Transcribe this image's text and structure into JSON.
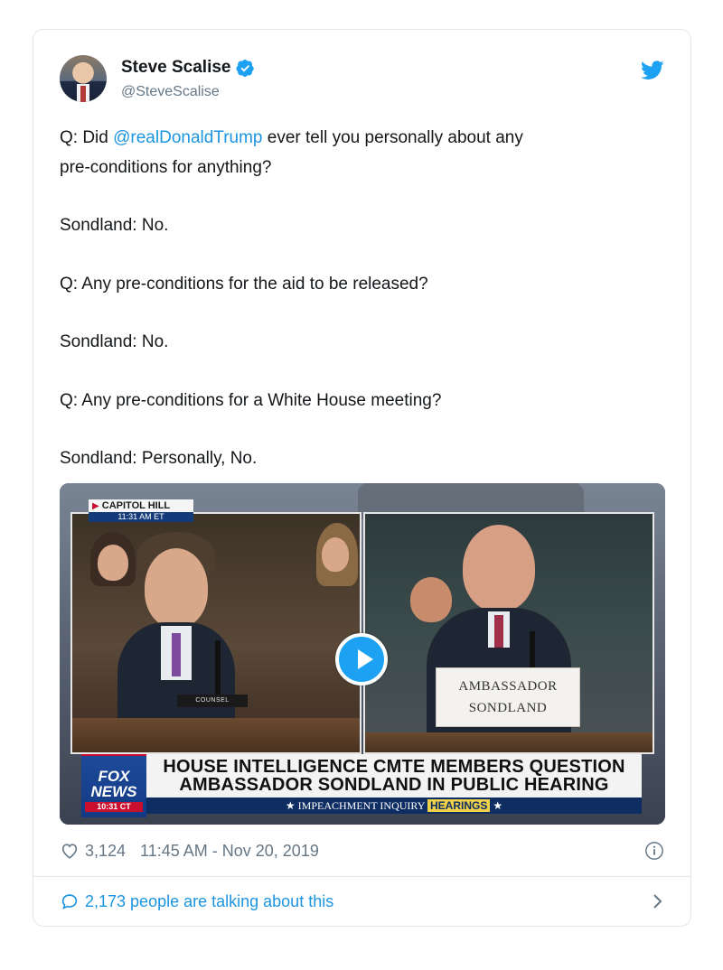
{
  "tweet": {
    "author_name": "Steve Scalise",
    "author_handle": "@SteveScalise",
    "text": {
      "line1_prefix": "Q: Did ",
      "mention": "@realDonaldTrump",
      "line1_suffix": " ever tell you personally about any",
      "line2": "pre-conditions for anything?",
      "line3": "Sondland: No.",
      "line4": "Q: Any pre-conditions for the aid to be released?",
      "line5": "Sondland: No.",
      "line6": "Q: Any pre-conditions for a White House meeting?",
      "line7": "Sondland: Personally, No."
    },
    "media": {
      "location_label": "CAPITOL HILL",
      "location_time": "11:31 AM ET",
      "counsel_sign": "COUNSEL",
      "nameplate_line1": "AMBASSADOR",
      "nameplate_line2": "SONDLAND",
      "network_line1": "FOX",
      "network_line2": "NEWS",
      "network_time": "10:31 CT",
      "headline_line1": "HOUSE INTELLIGENCE CMTE MEMBERS QUESTION",
      "headline_line2": "AMBASSADOR SONDLAND IN PUBLIC HEARING",
      "ticker_prefix": "★ IMPEACHMENT INQUIRY",
      "ticker_highlight": "HEARINGS",
      "ticker_suffix": "★"
    },
    "likes": "3,124",
    "timestamp": "11:45 AM - Nov 20, 2019",
    "talking": "2,173 people are talking about this"
  },
  "colors": {
    "link": "#1b95e0",
    "twitter_blue": "#1da1f2",
    "muted": "#657786"
  },
  "icons": [
    "verified-icon",
    "twitter-bird-icon",
    "play-icon",
    "heart-icon",
    "info-icon",
    "reply-bubble-icon",
    "chevron-right-icon"
  ]
}
